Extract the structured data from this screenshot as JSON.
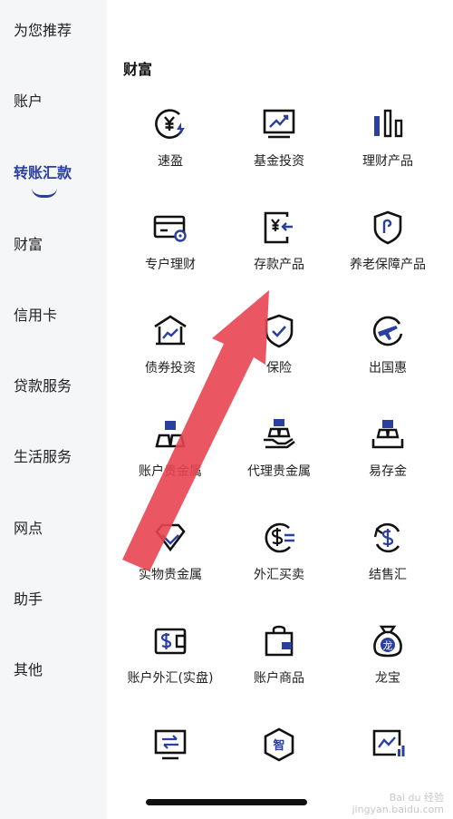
{
  "sidebar": {
    "items": [
      {
        "label": "为您推荐"
      },
      {
        "label": "账户"
      },
      {
        "label": "转账汇款",
        "active": true
      },
      {
        "label": "财富"
      },
      {
        "label": "信用卡"
      },
      {
        "label": "贷款服务"
      },
      {
        "label": "生活服务"
      },
      {
        "label": "网点"
      },
      {
        "label": "助手"
      },
      {
        "label": "其他"
      }
    ]
  },
  "main": {
    "section_title": "财富",
    "products": [
      {
        "label": "速盈",
        "icon": "yen-lightning-icon"
      },
      {
        "label": "基金投资",
        "icon": "stock-chart-icon"
      },
      {
        "label": "理财产品",
        "icon": "bar-chart-icon"
      },
      {
        "label": "专户理财",
        "icon": "card-coin-icon"
      },
      {
        "label": "存款产品",
        "icon": "yen-deposit-icon"
      },
      {
        "label": "养老保障产品",
        "icon": "shield-hook-icon"
      },
      {
        "label": "债券投资",
        "icon": "building-chart-icon"
      },
      {
        "label": "保险",
        "icon": "shield-check-icon"
      },
      {
        "label": "出国惠",
        "icon": "plane-globe-icon"
      },
      {
        "label": "账户贵金属",
        "icon": "gold-bars-icon"
      },
      {
        "label": "代理贵金属",
        "icon": "gold-hand-icon"
      },
      {
        "label": "易存金",
        "icon": "gold-tray-icon"
      },
      {
        "label": "实物贵金属",
        "icon": "diamond-icon"
      },
      {
        "label": "外汇买卖",
        "icon": "dollar-exchange-icon"
      },
      {
        "label": "结售汇",
        "icon": "dollar-cycle-icon"
      },
      {
        "label": "账户外汇(实盘)",
        "icon": "dollar-wallet-icon"
      },
      {
        "label": "账户商品",
        "icon": "shopping-bag-icon"
      },
      {
        "label": "龙宝",
        "icon": "dragon-bag-icon"
      },
      {
        "label": "",
        "icon": "monitor-transfer-icon"
      },
      {
        "label": "",
        "icon": "smart-badge-icon"
      },
      {
        "label": "",
        "icon": "trend-chart-icon"
      }
    ],
    "icon_text": {
      "dragon_char": "龙",
      "smart_char": "智"
    }
  },
  "watermark": {
    "line1": "Bai du 经验",
    "line2": "jingyan.baidu.com"
  },
  "colors": {
    "accent": "#2b3f9f",
    "arrow": "#e84450",
    "sidebar_bg": "#f5f6f8"
  }
}
